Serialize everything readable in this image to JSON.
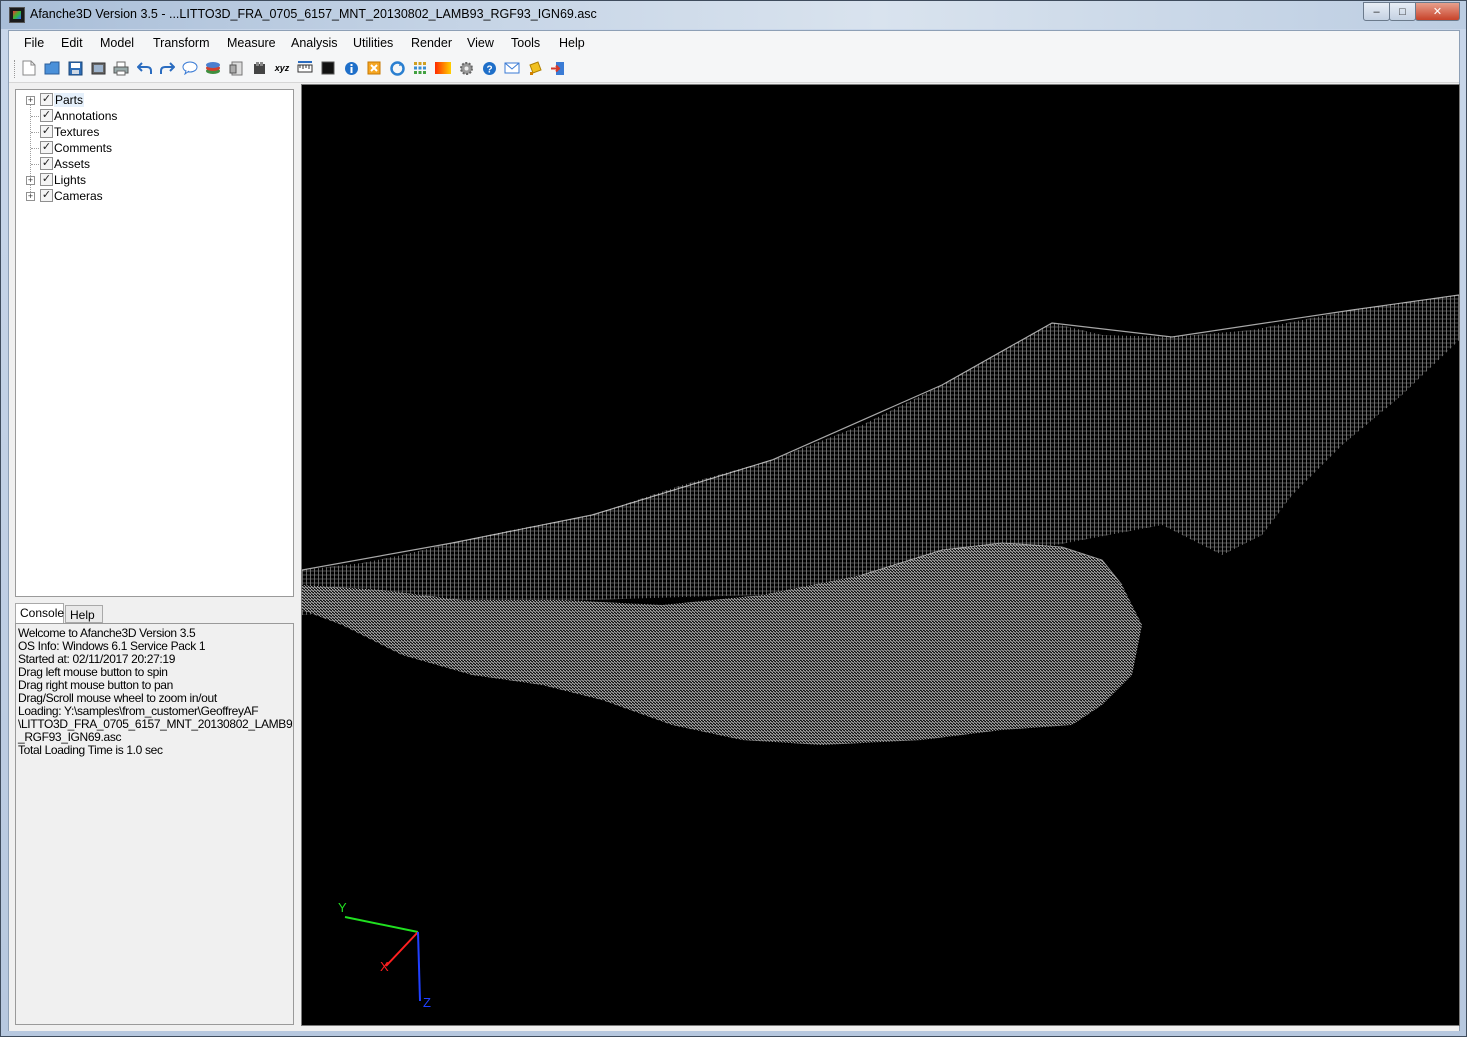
{
  "window": {
    "title": "Afanche3D Version 3.5 - ...LITTO3D_FRA_0705_6157_MNT_20130802_LAMB93_RGF93_IGN69.asc",
    "minimize_label": "–",
    "maximize_label": "□",
    "close_label": "✕"
  },
  "menu": {
    "items": [
      "File",
      "Edit",
      "Model",
      "Transform",
      "Measure",
      "Analysis",
      "Utilities",
      "Render",
      "View",
      "Tools",
      "Help"
    ]
  },
  "toolbar": {
    "icons": [
      "new-file-icon",
      "open-folder-icon",
      "save-icon",
      "screenshot-icon",
      "print-icon",
      "undo-icon",
      "redo-icon",
      "comment-icon",
      "layers-icon",
      "export-icon",
      "cube-icon",
      "xyz-icon",
      "ruler-icon",
      "black-square-icon",
      "info-icon",
      "close-box-icon",
      "refresh-icon",
      "grid-icon",
      "color-gradient-icon",
      "gear-icon",
      "help-icon",
      "mail-icon",
      "tag-icon",
      "exit-icon"
    ],
    "xyz_label": "xyz"
  },
  "tree": {
    "items": [
      {
        "label": "Parts",
        "checked": true,
        "expandable": true
      },
      {
        "label": "Annotations",
        "checked": true,
        "expandable": false
      },
      {
        "label": "Textures",
        "checked": true,
        "expandable": false
      },
      {
        "label": "Comments",
        "checked": true,
        "expandable": false
      },
      {
        "label": "Assets",
        "checked": true,
        "expandable": false
      },
      {
        "label": "Lights",
        "checked": true,
        "expandable": true
      },
      {
        "label": "Cameras",
        "checked": true,
        "expandable": true
      }
    ],
    "check_glyph": "✓",
    "expand_glyph": "+"
  },
  "tabs": {
    "console": "Console",
    "help": "Help"
  },
  "console": {
    "lines": [
      "Welcome to Afanche3D Version 3.5",
      "OS Info: Windows 6.1 Service Pack 1",
      "Started at: 02/11/2017 20:27:19",
      "",
      "Drag left mouse button to spin",
      "Drag right mouse button to pan",
      "Drag/Scroll mouse wheel to zoom in/out",
      "",
      "Loading: Y:\\samples\\from_customer\\GeoffreyAF",
      "\\LITTO3D_FRA_0705_6157_MNT_20130802_LAMB93",
      "_RGF93_IGN69.asc",
      "Total Loading Time is 1.0 sec"
    ]
  },
  "axes": {
    "x_label": "X",
    "y_label": "Y",
    "z_label": "Z",
    "x_color": "#ff2020",
    "y_color": "#20e020",
    "z_color": "#2040ff"
  }
}
